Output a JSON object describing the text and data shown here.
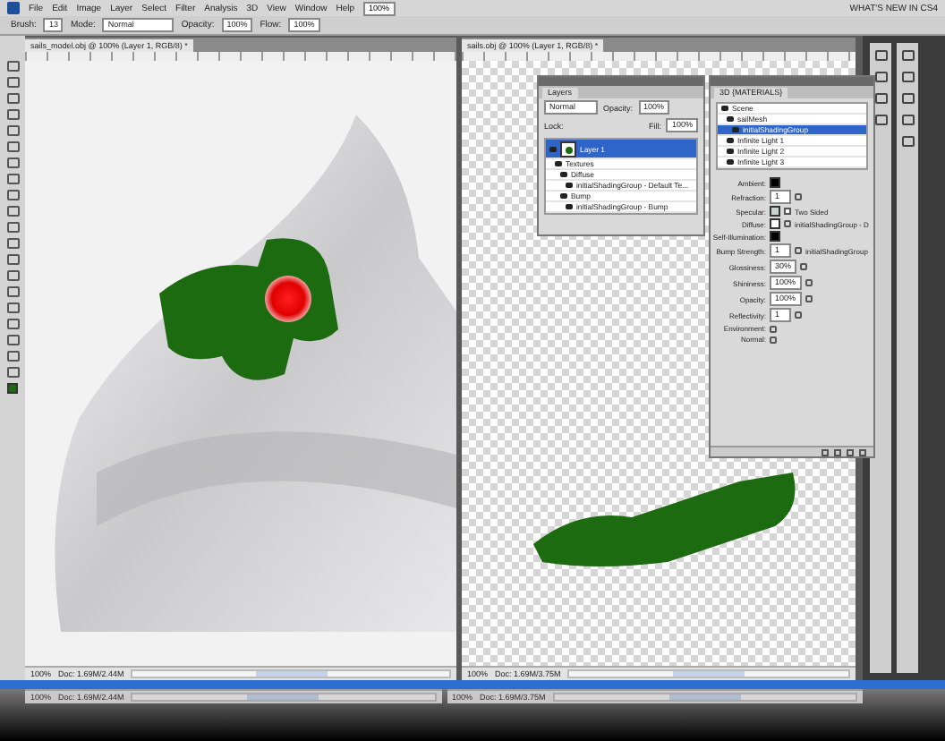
{
  "menu_bar": {
    "items": [
      "File",
      "Edit",
      "Image",
      "Layer",
      "Select",
      "Filter",
      "Analysis",
      "3D",
      "View",
      "Window",
      "Help"
    ],
    "zoom": "100%",
    "workspace": "WHAT'S NEW IN CS4"
  },
  "options_bar": {
    "brush_label": "Brush:",
    "brush_size": "13",
    "mode_label": "Mode:",
    "mode": "Normal",
    "opacity_label": "Opacity:",
    "opacity": "100%",
    "flow_label": "Flow:",
    "flow": "100%"
  },
  "documents": [
    {
      "kind": "cloth",
      "title": "sails_model.obj @ 100% (Layer 1, RGB/8) *",
      "zoom": "100%",
      "doc_size": "Doc: 1.69M/2.44M"
    },
    {
      "kind": "transparent",
      "title": "sails.obj @ 100% (Layer 1, RGB/8) *",
      "zoom": "100%",
      "doc_size": "Doc: 1.69M/3.75M"
    }
  ],
  "layers_panel": {
    "tab": "Layers",
    "blend_mode": "Normal",
    "opacity_label": "Opacity:",
    "opacity": "100%",
    "lock_label": "Lock:",
    "fill_label": "Fill:",
    "fill": "100%",
    "layers": [
      {
        "name": "Layer 1",
        "selected": true,
        "children": [
          {
            "name": "Textures",
            "selected": false,
            "children": [
              {
                "name": "Diffuse",
                "selected": false,
                "children": [
                  {
                    "name": "initialShadingGroup - Default Te...",
                    "selected": false
                  }
                ]
              },
              {
                "name": "Bump",
                "selected": false,
                "children": [
                  {
                    "name": "initialShadingGroup - Bump",
                    "selected": false
                  }
                ]
              }
            ]
          }
        ]
      }
    ]
  },
  "panel_3d": {
    "tab": "3D {MATERIALS}",
    "scene": [
      {
        "name": "Scene",
        "selected": false,
        "children": [
          {
            "name": "sailMesh",
            "selected": false,
            "children": [
              {
                "name": "initialShadingGroup",
                "selected": true
              }
            ]
          },
          {
            "name": "Infinite Light 1",
            "selected": false
          },
          {
            "name": "Infinite Light 2",
            "selected": false
          },
          {
            "name": "Infinite Light 3",
            "selected": false
          }
        ]
      }
    ],
    "properties": [
      {
        "kind": "swatch",
        "label": "Ambient:",
        "color": "#000000"
      },
      {
        "kind": "field",
        "label": "Refraction:",
        "value": "1"
      },
      {
        "kind": "check",
        "label": "Specular:",
        "color": "#c8d4d0",
        "option": "Two Sided",
        "checked": false
      },
      {
        "kind": "swatch",
        "label": "Diffuse:",
        "color": "#ffffff",
        "texture": "initialShadingGroup - D"
      },
      {
        "kind": "swatch",
        "label": "Self-Illumination:",
        "color": "#000000"
      },
      {
        "kind": "field",
        "label": "Bump Strength:",
        "value": "1",
        "texture": "initialShadingGroup"
      },
      {
        "kind": "field",
        "label": "Glossiness:",
        "value": "30%"
      },
      {
        "kind": "field",
        "label": "Shininess:",
        "value": "100%"
      },
      {
        "kind": "field",
        "label": "Opacity:",
        "value": "100%"
      },
      {
        "kind": "field",
        "label": "Reflectivity:",
        "value": "1"
      },
      {
        "kind": "texture",
        "label": "Environment:"
      },
      {
        "kind": "texture",
        "label": "Normal:"
      }
    ]
  },
  "status_reflection": [
    {
      "zoom": "100%",
      "doc_size": "Doc: 1.69M/2.44M"
    },
    {
      "zoom": "100%",
      "doc_size": "Doc: 1.69M/3.75M"
    }
  ]
}
